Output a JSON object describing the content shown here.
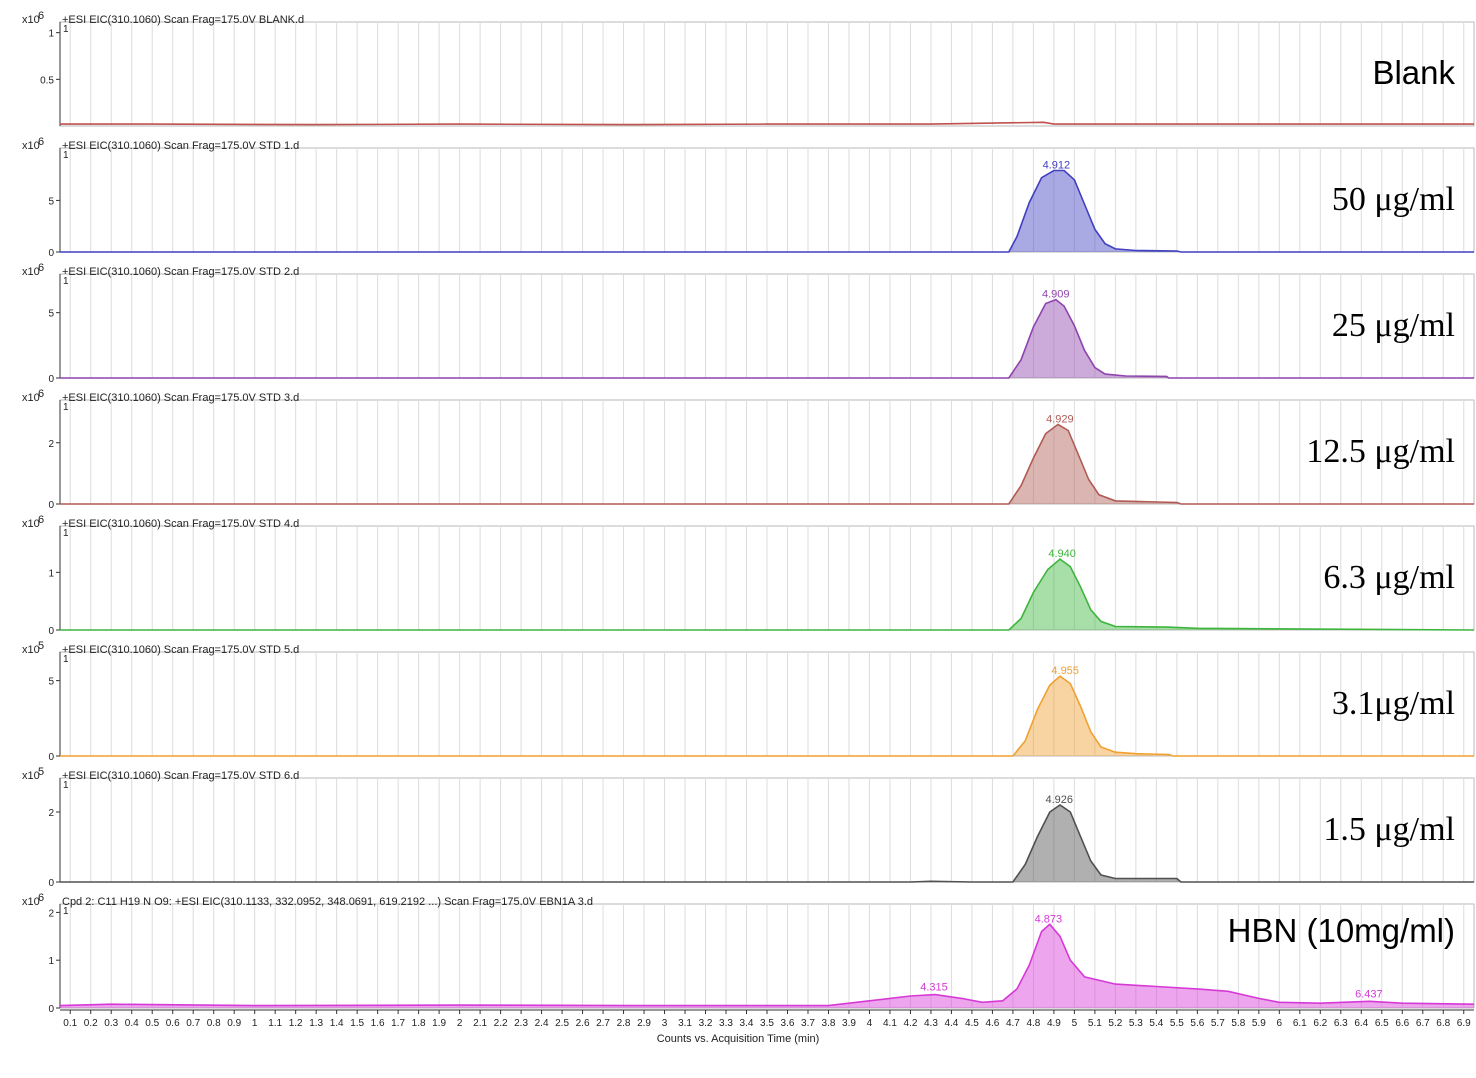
{
  "chart_data": {
    "type": "line",
    "title": "",
    "xlabel": "Counts vs. Acquisition Time (min)",
    "xlim": [
      0.05,
      6.95
    ],
    "x_ticks": [
      "0.1",
      "0.2",
      "0.3",
      "0.4",
      "0.5",
      "0.6",
      "0.7",
      "0.8",
      "0.9",
      "1",
      "1.1",
      "1.2",
      "1.3",
      "1.4",
      "1.5",
      "1.6",
      "1.7",
      "1.8",
      "1.9",
      "2",
      "2.1",
      "2.2",
      "2.3",
      "2.4",
      "2.5",
      "2.6",
      "2.7",
      "2.8",
      "2.9",
      "3",
      "3.1",
      "3.2",
      "3.3",
      "3.4",
      "3.5",
      "3.6",
      "3.7",
      "3.8",
      "3.9",
      "4",
      "4.1",
      "4.2",
      "4.3",
      "4.4",
      "4.5",
      "4.6",
      "4.7",
      "4.8",
      "4.9",
      "5",
      "5.1",
      "5.2",
      "5.3",
      "5.4",
      "5.5",
      "5.6",
      "5.7",
      "5.8",
      "5.9",
      "6",
      "6.1",
      "6.2",
      "6.3",
      "6.4",
      "6.5",
      "6.6",
      "6.7",
      "6.8",
      "6.9"
    ],
    "grid": true,
    "panels": [
      {
        "header": "+ESI EIC(310.1060) Scan Frag=175.0V BLANK.d",
        "scale": "x10",
        "exponent": "6",
        "label": "Blank",
        "ylim": [
          0,
          1.05
        ],
        "yticks": [
          "1",
          "0.5"
        ],
        "tick_values": [
          1,
          0.5
        ],
        "color": "#c0504d",
        "fill": false,
        "peak_label": "",
        "points": [
          [
            0.05,
            0.02
          ],
          [
            0.5,
            0.02
          ],
          [
            1.3,
            0.015
          ],
          [
            2.0,
            0.02
          ],
          [
            2.8,
            0.015
          ],
          [
            3.5,
            0.02
          ],
          [
            4.3,
            0.02
          ],
          [
            4.85,
            0.04
          ],
          [
            4.9,
            0.02
          ],
          [
            5.5,
            0.02
          ],
          [
            6.2,
            0.02
          ],
          [
            6.95,
            0.02
          ]
        ]
      },
      {
        "header": "+ESI EIC(310.1060) Scan Frag=175.0V STD 1.d",
        "scale": "x10",
        "exponent": "6",
        "label": "50 μg/ml",
        "ylim": [
          0,
          9.5
        ],
        "yticks": [
          "5",
          "0"
        ],
        "tick_values": [
          5,
          0
        ],
        "color": "#4040c0",
        "fill": true,
        "peak_label": "4.912",
        "peak_x": 4.912,
        "points": [
          [
            0.05,
            0
          ],
          [
            4.68,
            0
          ],
          [
            4.72,
            1.5
          ],
          [
            4.78,
            4.8
          ],
          [
            4.84,
            7.2
          ],
          [
            4.9,
            7.9
          ],
          [
            4.95,
            7.9
          ],
          [
            5.0,
            7.0
          ],
          [
            5.05,
            4.6
          ],
          [
            5.1,
            2.2
          ],
          [
            5.15,
            0.8
          ],
          [
            5.2,
            0.3
          ],
          [
            5.3,
            0.15
          ],
          [
            5.5,
            0.1
          ],
          [
            5.52,
            0
          ],
          [
            6.95,
            0
          ]
        ]
      },
      {
        "header": "+ESI EIC(310.1060) Scan Frag=175.0V STD 2.d",
        "scale": "x10",
        "exponent": "6",
        "label": "25 μg/ml",
        "ylim": [
          0,
          7.5
        ],
        "yticks": [
          "5",
          "0"
        ],
        "tick_values": [
          5,
          0
        ],
        "color": "#8e44ad",
        "fill": true,
        "peak_label": "4.909",
        "peak_x": 4.909,
        "points": [
          [
            0.05,
            0
          ],
          [
            4.68,
            0
          ],
          [
            4.74,
            1.4
          ],
          [
            4.8,
            3.9
          ],
          [
            4.86,
            5.7
          ],
          [
            4.91,
            6.0
          ],
          [
            4.95,
            5.5
          ],
          [
            5.0,
            4.0
          ],
          [
            5.05,
            2.1
          ],
          [
            5.1,
            0.8
          ],
          [
            5.15,
            0.3
          ],
          [
            5.25,
            0.15
          ],
          [
            5.45,
            0.12
          ],
          [
            5.46,
            0
          ],
          [
            6.95,
            0
          ]
        ]
      },
      {
        "header": "+ESI EIC(310.1060) Scan Frag=175.0V STD 3.d",
        "scale": "x10",
        "exponent": "6",
        "label": "12.5 μg/ml",
        "ylim": [
          0,
          3.2
        ],
        "yticks": [
          "2",
          "0"
        ],
        "tick_values": [
          2,
          0
        ],
        "color": "#b05a55",
        "fill": true,
        "peak_label": "4.929",
        "peak_x": 4.929,
        "points": [
          [
            0.05,
            0
          ],
          [
            4.68,
            0
          ],
          [
            4.74,
            0.6
          ],
          [
            4.8,
            1.5
          ],
          [
            4.86,
            2.3
          ],
          [
            4.92,
            2.6
          ],
          [
            4.97,
            2.4
          ],
          [
            5.02,
            1.6
          ],
          [
            5.07,
            0.8
          ],
          [
            5.12,
            0.3
          ],
          [
            5.2,
            0.1
          ],
          [
            5.5,
            0.05
          ],
          [
            5.52,
            0
          ],
          [
            6.95,
            0
          ]
        ]
      },
      {
        "header": "+ESI EIC(310.1060) Scan Frag=175.0V STD 4.d",
        "scale": "x10",
        "exponent": "6",
        "label": "6.3 μg/ml",
        "ylim": [
          0,
          1.7
        ],
        "yticks": [
          "1",
          "0"
        ],
        "tick_values": [
          1,
          0
        ],
        "color": "#3db53d",
        "fill": true,
        "peak_label": "4.940",
        "peak_x": 4.94,
        "points": [
          [
            0.05,
            0
          ],
          [
            4.68,
            0
          ],
          [
            4.74,
            0.2
          ],
          [
            4.8,
            0.65
          ],
          [
            4.87,
            1.05
          ],
          [
            4.93,
            1.23
          ],
          [
            4.98,
            1.1
          ],
          [
            5.03,
            0.75
          ],
          [
            5.08,
            0.35
          ],
          [
            5.13,
            0.15
          ],
          [
            5.2,
            0.06
          ],
          [
            5.45,
            0.05
          ],
          [
            5.6,
            0.03
          ],
          [
            6.95,
            0
          ]
        ]
      },
      {
        "header": "+ESI EIC(310.1060) Scan Frag=175.0V STD 5.d",
        "scale": "x10",
        "exponent": "5",
        "label": "3.1μg/ml",
        "ylim": [
          0,
          6.5
        ],
        "yticks": [
          "5",
          "0"
        ],
        "tick_values": [
          5,
          0
        ],
        "color": "#f0a030",
        "fill": true,
        "peak_label": "4.955",
        "peak_x": 4.955,
        "points": [
          [
            0.05,
            0
          ],
          [
            4.7,
            0
          ],
          [
            4.76,
            1.0
          ],
          [
            4.82,
            3.1
          ],
          [
            4.88,
            4.7
          ],
          [
            4.93,
            5.3
          ],
          [
            4.98,
            4.8
          ],
          [
            5.03,
            3.3
          ],
          [
            5.08,
            1.6
          ],
          [
            5.13,
            0.6
          ],
          [
            5.2,
            0.25
          ],
          [
            5.3,
            0.15
          ],
          [
            5.46,
            0.1
          ],
          [
            5.48,
            0
          ],
          [
            6.95,
            0
          ]
        ]
      },
      {
        "header": "+ESI EIC(310.1060) Scan Frag=175.0V STD 6.d",
        "scale": "x10",
        "exponent": "5",
        "label": "1.5 μg/ml",
        "ylim": [
          0,
          2.8
        ],
        "yticks": [
          "2",
          "0"
        ],
        "tick_values": [
          2,
          0
        ],
        "color": "#505050",
        "fill": true,
        "peak_label": "4.926",
        "peak_x": 4.926,
        "points": [
          [
            0.05,
            0
          ],
          [
            4.2,
            0
          ],
          [
            4.3,
            0.02
          ],
          [
            4.5,
            0
          ],
          [
            4.7,
            0
          ],
          [
            4.76,
            0.5
          ],
          [
            4.82,
            1.3
          ],
          [
            4.88,
            2.0
          ],
          [
            4.93,
            2.2
          ],
          [
            4.98,
            2.0
          ],
          [
            5.03,
            1.3
          ],
          [
            5.08,
            0.6
          ],
          [
            5.13,
            0.2
          ],
          [
            5.2,
            0.1
          ],
          [
            5.5,
            0.1
          ],
          [
            5.52,
            0
          ],
          [
            6.95,
            0
          ]
        ]
      },
      {
        "header": "Cpd 2: C11 H19 N O9: +ESI EIC(310.1133, 332.0952, 348.0691, 619.2192 ...) Scan Frag=175.0V EBN1A 3.d",
        "scale": "x10",
        "exponent": "6",
        "label": "HBN (10mg/ml)",
        "ylim": [
          0,
          2.05
        ],
        "yticks": [
          "2",
          "1",
          "0"
        ],
        "tick_values": [
          2,
          1,
          0
        ],
        "color": "#d63ad6",
        "fill": true,
        "peak_label": "4.873",
        "peak_x": 4.873,
        "extra_labels": [
          {
            "text": "4.315",
            "x": 4.315
          },
          {
            "text": "6.437",
            "x": 6.437
          }
        ],
        "points": [
          [
            0.05,
            0.05
          ],
          [
            0.3,
            0.08
          ],
          [
            1.0,
            0.05
          ],
          [
            2.0,
            0.06
          ],
          [
            3.0,
            0.05
          ],
          [
            3.8,
            0.05
          ],
          [
            4.0,
            0.15
          ],
          [
            4.2,
            0.25
          ],
          [
            4.32,
            0.28
          ],
          [
            4.45,
            0.2
          ],
          [
            4.55,
            0.12
          ],
          [
            4.65,
            0.15
          ],
          [
            4.72,
            0.4
          ],
          [
            4.78,
            0.9
          ],
          [
            4.84,
            1.6
          ],
          [
            4.88,
            1.75
          ],
          [
            4.93,
            1.5
          ],
          [
            4.98,
            1.0
          ],
          [
            5.05,
            0.65
          ],
          [
            5.2,
            0.5
          ],
          [
            5.4,
            0.45
          ],
          [
            5.6,
            0.4
          ],
          [
            5.75,
            0.35
          ],
          [
            5.9,
            0.2
          ],
          [
            6.0,
            0.12
          ],
          [
            6.2,
            0.1
          ],
          [
            6.44,
            0.14
          ],
          [
            6.6,
            0.1
          ],
          [
            6.95,
            0.08
          ]
        ]
      }
    ]
  }
}
